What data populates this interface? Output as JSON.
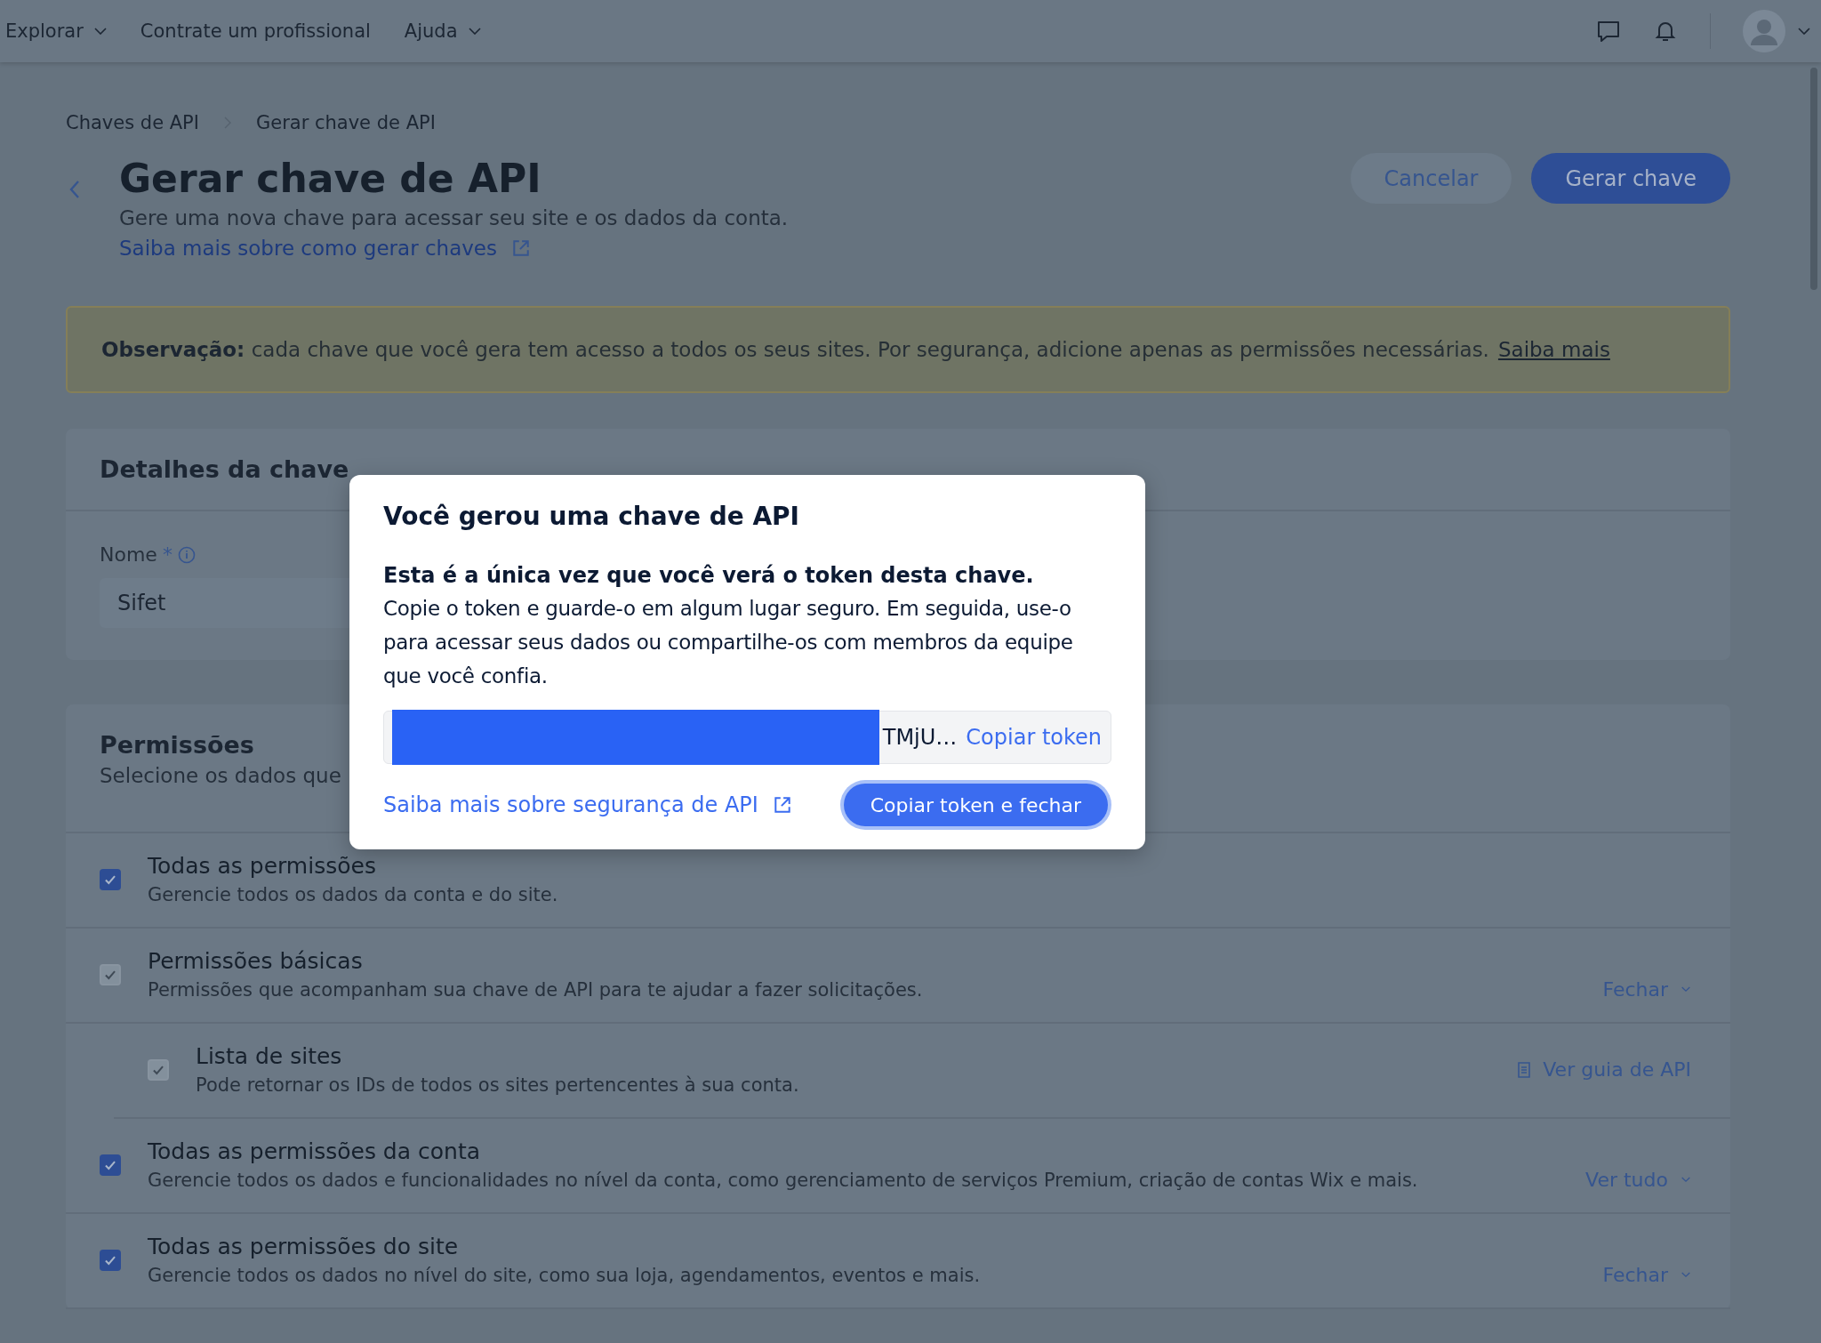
{
  "topbar": {
    "menu": [
      {
        "label": "Explorar",
        "has_caret": true
      },
      {
        "label": "Contrate um profissional",
        "has_caret": false
      },
      {
        "label": "Ajuda",
        "has_caret": true
      }
    ]
  },
  "breadcrumb": [
    "Chaves de API",
    "Gerar chave de API"
  ],
  "header": {
    "title": "Gerar chave de API",
    "subtitle": "Gere uma nova chave para acessar seu site e os dados da conta.",
    "link": "Saiba mais sobre como gerar chaves",
    "buttons": [
      {
        "label": "Cancelar",
        "kind": "secondary"
      },
      {
        "label": "Gerar chave",
        "kind": "primary"
      }
    ]
  },
  "note": {
    "label": "Observação:",
    "text": "cada chave que você gera tem acesso a todos os seus sites. Por segurança, adicione apenas as permissões necessárias.",
    "link": "Saiba mais"
  },
  "key_details": {
    "title": "Detalhes da chave",
    "name_label": "Nome",
    "required_mark": "*",
    "name_value": "Sifet"
  },
  "permissions": {
    "title": "Permissões",
    "subtitle": "Selecione os dados que",
    "items": [
      {
        "title": "Todas as permissões",
        "description": "Gerencie todos os dados da conta e do site.",
        "checked": true,
        "disabled": false
      },
      {
        "title": "Permissões básicas",
        "description": "Permissões que acompanham sua chave de API para te ajudar a fazer solicitações.",
        "checked": true,
        "disabled": true,
        "action": {
          "label": "Fechar",
          "kind": "toggle"
        },
        "children": [
          {
            "title": "Lista de sites",
            "description": "Pode retornar os IDs de todos os sites pertencentes à sua conta.",
            "checked": true,
            "disabled": true,
            "action": {
              "label": "Ver guia de API",
              "kind": "guide"
            }
          }
        ]
      },
      {
        "title": "Todas as permissões da conta",
        "description": "Gerencie todos os dados e funcionalidades no nível da conta, como gerenciamento de serviços Premium, criação de contas Wix e mais.",
        "checked": true,
        "disabled": false,
        "action": {
          "label": "Ver tudo",
          "kind": "toggle"
        }
      },
      {
        "title": "Todas as permissões do site",
        "description": "Gerencie todos os dados no nível do site, como sua loja, agendamentos, eventos e mais.",
        "checked": true,
        "disabled": false,
        "action": {
          "label": "Fechar",
          "kind": "toggle"
        }
      }
    ]
  },
  "modal": {
    "title": "Você gerou uma chave de API",
    "bold_text": "Esta é a única vez que você verá o token desta chave.",
    "text": "Copie o token e guarde-o em algum lugar seguro. Em seguida, use-o para acessar seus dados ou compartilhe-os com membros da equipe que você confia.",
    "token_suffix": "TMjU…",
    "copy_token": "Copiar token",
    "link": "Saiba mais sobre segurança de API",
    "button": "Copiar token e fechar"
  }
}
